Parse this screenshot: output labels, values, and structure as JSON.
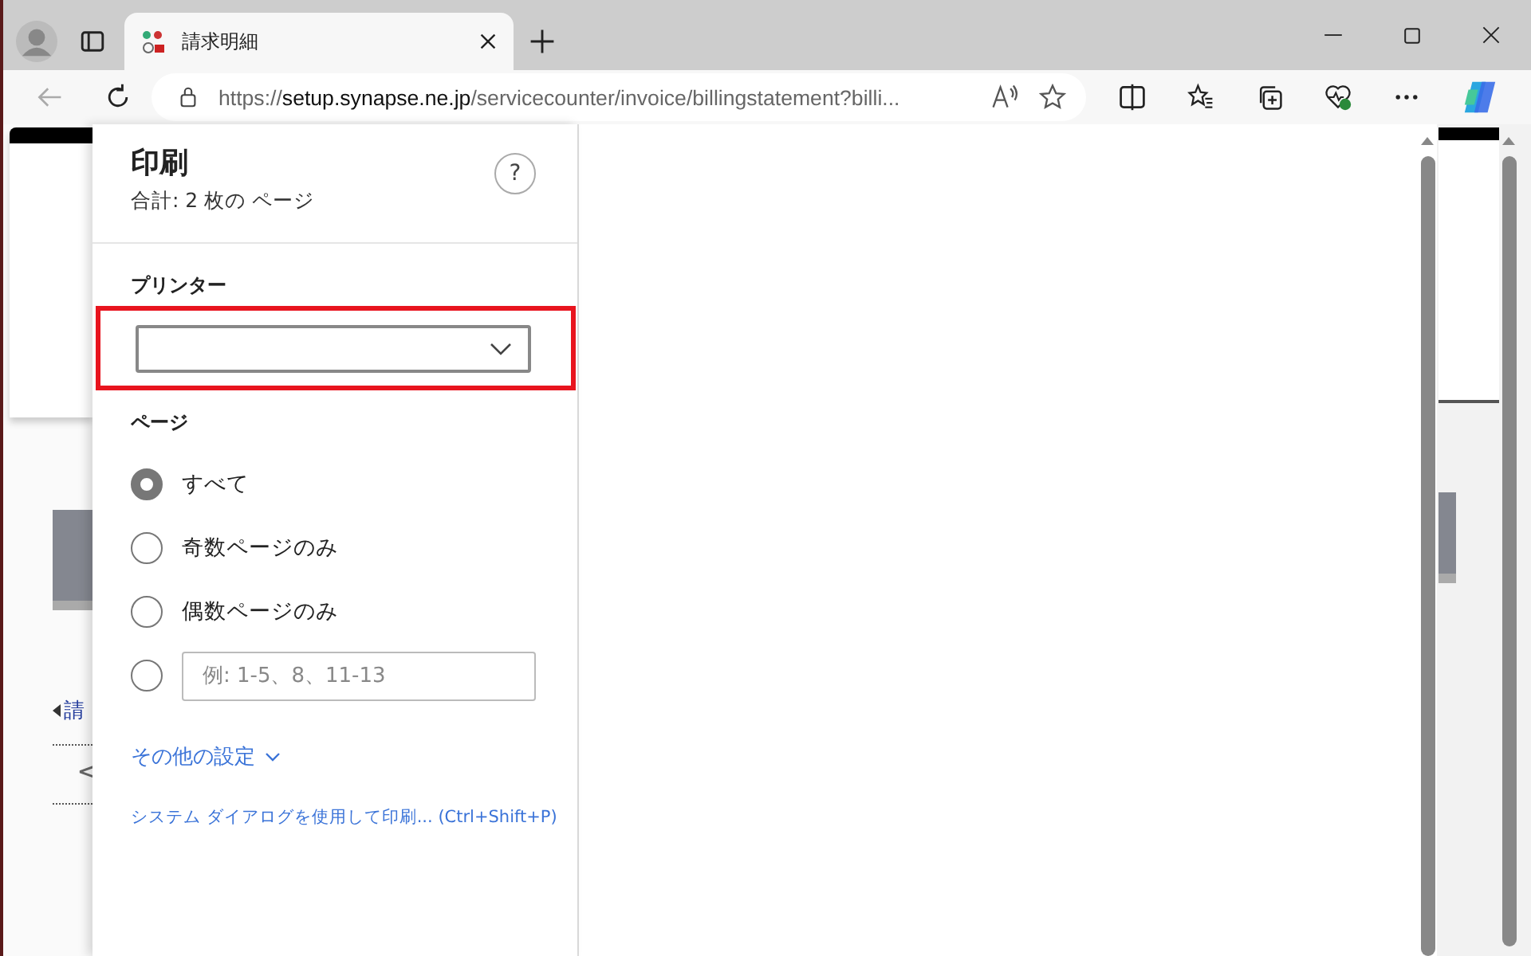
{
  "browser": {
    "tab": {
      "title": "請求明細"
    },
    "url": {
      "scheme": "https://",
      "host": "setup.synapse.ne.jp",
      "path": "/servicecounter/invoice/billingstatement?billi..."
    }
  },
  "page": {
    "back_link": "請",
    "pager_prev": "<"
  },
  "print": {
    "title": "印刷",
    "subtitle": "合計: 2 枚の ページ",
    "help": "?",
    "printer": {
      "label": "プリンター",
      "highlighted": true
    },
    "pages": {
      "label": "ページ",
      "options": [
        {
          "kind": "choice",
          "label": "すべて",
          "selected": true
        },
        {
          "kind": "choice",
          "label": "奇数ページのみ",
          "selected": false
        },
        {
          "kind": "choice",
          "label": "偶数ページのみ",
          "selected": false
        },
        {
          "kind": "range",
          "placeholder": "例: 1-5、8、11-13",
          "selected": false
        }
      ]
    },
    "more_settings": "その他の設定",
    "system_dialog": "システム ダイアログを使用して印刷... (Ctrl+Shift+P)"
  }
}
